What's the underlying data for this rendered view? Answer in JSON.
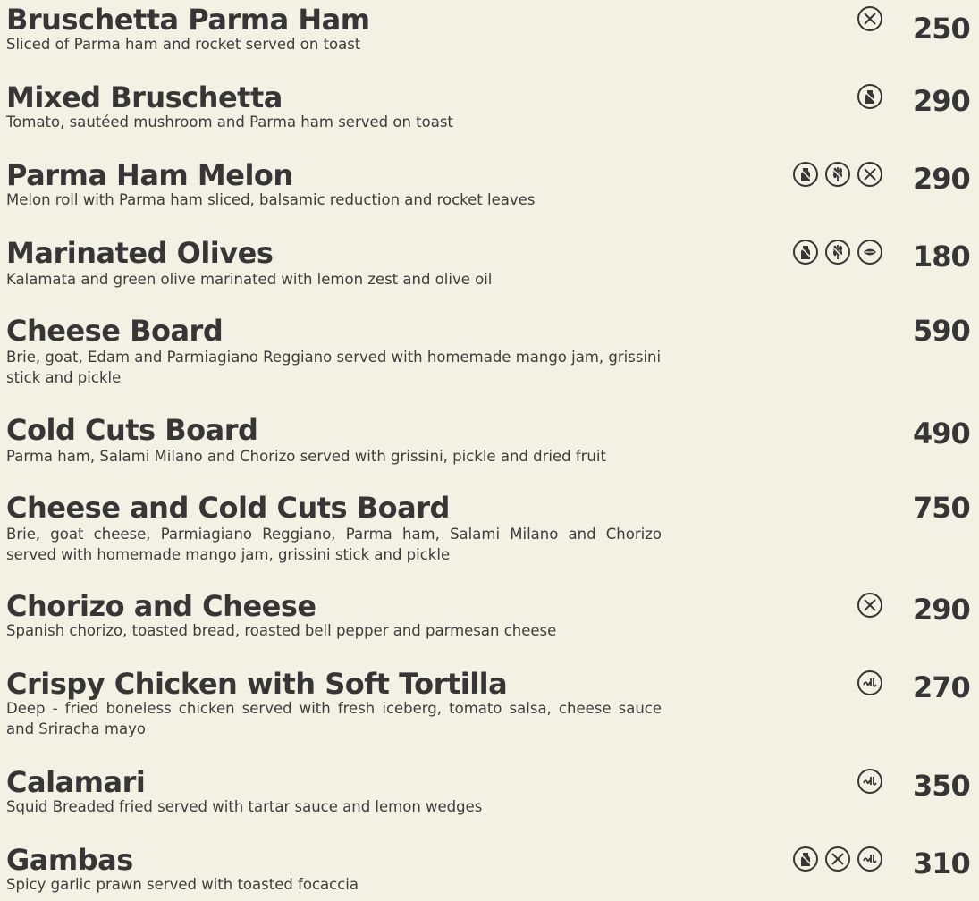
{
  "items": [
    {
      "name": "Bruschetta Parma Ham",
      "desc": "Sliced of Parma ham and rocket served on toast",
      "price": "250",
      "icons": [
        "no-cutlery-icon"
      ]
    },
    {
      "name": "Mixed Bruschetta",
      "desc": "Tomato, sautéed mushroom and Parma ham served on toast",
      "price": "290",
      "icons": [
        "dairy-icon"
      ]
    },
    {
      "name": "Parma Ham Melon",
      "desc": "Melon roll with Parma ham sliced, balsamic reduction and rocket leaves",
      "price": "290",
      "icons": [
        "dairy-icon",
        "gluten-icon",
        "no-cutlery-icon"
      ]
    },
    {
      "name": "Marinated Olives",
      "desc": "Kalamata and green olive marinated with lemon zest and olive oil",
      "price": "180",
      "icons": [
        "dairy-icon",
        "gluten-icon",
        "vegan-leaf-icon"
      ]
    },
    {
      "name": "Cheese Board",
      "desc": "Brie, goat, Edam and Parmiagiano Reggiano served with homemade mango jam, grissini stick and pickle",
      "price": "590",
      "icons": []
    },
    {
      "name": "Cold Cuts Board",
      "desc": "Parma ham, Salami Milano and Chorizo served with grissini, pickle and dried fruit",
      "price": "490",
      "icons": []
    },
    {
      "name": "Cheese and Cold Cuts Board",
      "desc": "Brie, goat cheese, Parmiagiano Reggiano, Parma ham, Salami Milano and Chorizo served with homemade mango jam, grissini stick and pickle",
      "price": "750",
      "icons": []
    },
    {
      "name": "Chorizo and Cheese",
      "desc": "Spanish chorizo, toasted bread, roasted bell pepper and parmesan cheese",
      "price": "290",
      "icons": [
        "no-cutlery-icon"
      ]
    },
    {
      "name": "Crispy Chicken with Soft Tortilla",
      "desc": "Deep - fried boneless chicken served with fresh iceberg, tomato salsa, cheese sauce and Sriracha mayo",
      "price": "270",
      "icons": [
        "halal-icon"
      ]
    },
    {
      "name": "Calamari",
      "desc": "Squid Breaded fried served with tartar sauce and lemon wedges",
      "price": "350",
      "icons": [
        "halal-icon"
      ]
    },
    {
      "name": "Gambas",
      "desc": "Spicy garlic prawn served with toasted focaccia",
      "price": "310",
      "icons": [
        "dairy-icon",
        "no-cutlery-icon",
        "halal-icon"
      ]
    }
  ]
}
